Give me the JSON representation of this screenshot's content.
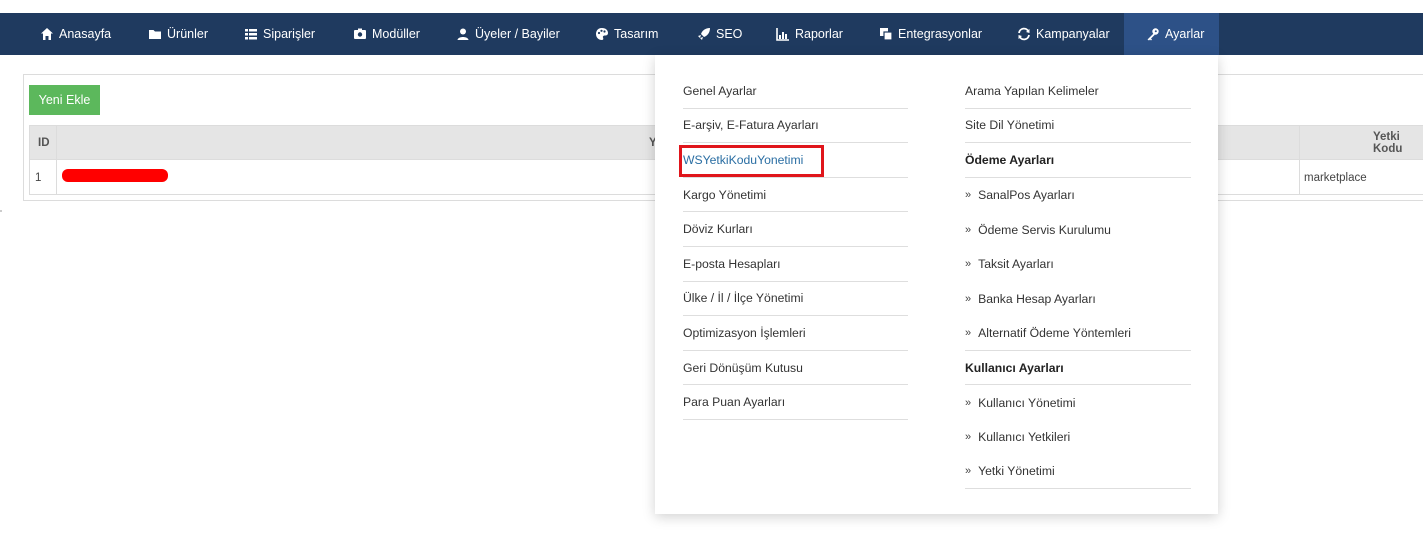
{
  "nav": {
    "items": [
      {
        "label": "Anasayfa",
        "icon": "home-icon"
      },
      {
        "label": "Ürünler",
        "icon": "folder-icon"
      },
      {
        "label": "Siparişler",
        "icon": "list-icon"
      },
      {
        "label": "Modüller",
        "icon": "box-icon"
      },
      {
        "label": "Üyeler / Bayiler",
        "icon": "user-icon"
      },
      {
        "label": "Tasarım",
        "icon": "palette-icon"
      },
      {
        "label": "SEO",
        "icon": "rocket-icon"
      },
      {
        "label": "Raporlar",
        "icon": "chart-icon"
      },
      {
        "label": "Entegrasyonlar",
        "icon": "copy-icon"
      },
      {
        "label": "Kampanyalar",
        "icon": "refresh-icon"
      },
      {
        "label": "Ayarlar",
        "icon": "key-icon"
      }
    ],
    "active": "Ayarlar",
    "bg_color": "#1f3a5f",
    "active_color": "#2d5187"
  },
  "toolbar": {
    "add_label": "Yeni Ekle"
  },
  "table": {
    "headers": {
      "id": "ID",
      "middle": "Y",
      "right": "Yetki Kodu"
    },
    "rows": [
      {
        "id": "1",
        "right": "marketplace"
      }
    ]
  },
  "dropdown": {
    "left": [
      {
        "label": "Genel Ayarlar"
      },
      {
        "label": "E-arşiv, E-Fatura Ayarları"
      },
      {
        "label": "WSYetkiKoduYonetimi",
        "highlighted": true
      },
      {
        "label": "Kargo Yönetimi"
      },
      {
        "label": "Döviz Kurları"
      },
      {
        "label": "E-posta Hesapları"
      },
      {
        "label": "Ülke / İl / İlçe Yönetimi"
      },
      {
        "label": "Optimizasyon İşlemleri"
      },
      {
        "label": "Geri Dönüşüm Kutusu"
      },
      {
        "label": "Para Puan Ayarları"
      }
    ],
    "right": [
      {
        "label": "Arama Yapılan Kelimeler"
      },
      {
        "label": "Site Dil Yönetimi"
      },
      {
        "label": "Ödeme Ayarları",
        "type": "header"
      },
      {
        "label": "SanalPos Ayarları",
        "type": "sub"
      },
      {
        "label": "Ödeme Servis Kurulumu",
        "type": "sub"
      },
      {
        "label": "Taksit Ayarları",
        "type": "sub"
      },
      {
        "label": "Banka Hesap Ayarları",
        "type": "sub"
      },
      {
        "label": "Alternatif Ödeme Yöntemleri",
        "type": "sub"
      },
      {
        "label": "Kullanıcı Ayarları",
        "type": "header"
      },
      {
        "label": "Kullanıcı Yönetimi",
        "type": "sub"
      },
      {
        "label": "Kullanıcı Yetkileri",
        "type": "sub"
      },
      {
        "label": "Yetki Yönetimi",
        "type": "sub"
      }
    ],
    "sub_marker": "»",
    "highlight_color": "#e0151b"
  }
}
